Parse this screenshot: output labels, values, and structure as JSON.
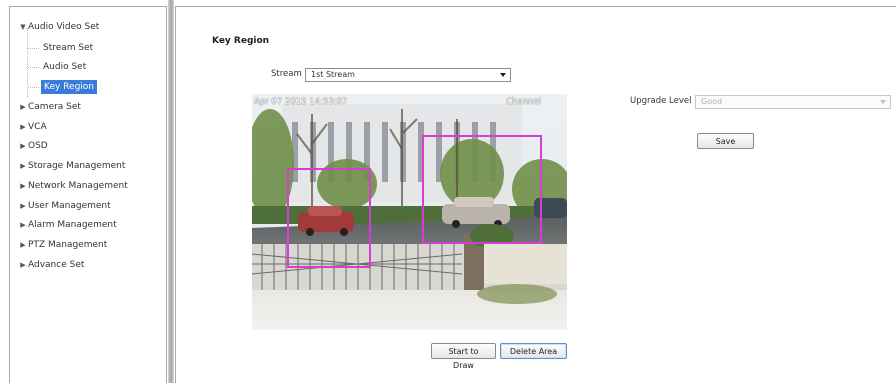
{
  "sidebar": {
    "root_expanded": {
      "label": "Audio Video Set",
      "arrow": "▼"
    },
    "children": [
      {
        "label": "Stream Set"
      },
      {
        "label": "Audio Set"
      },
      {
        "label": "Key Region",
        "selected": true
      }
    ],
    "collapsed_items": [
      {
        "label": "Camera Set"
      },
      {
        "label": "VCA"
      },
      {
        "label": "OSD"
      },
      {
        "label": "Storage Management"
      },
      {
        "label": "Network Management"
      },
      {
        "label": "User Management"
      },
      {
        "label": "Alarm Management"
      },
      {
        "label": "PTZ Management"
      },
      {
        "label": "Advance Set"
      }
    ],
    "collapsed_arrow": "▶"
  },
  "main": {
    "title": "Key Region",
    "stream_label": "Stream",
    "stream_value": "1st Stream",
    "video": {
      "timestamp": "Apr 07 2015 14:53:07",
      "channel": "Channel"
    },
    "upgrade_label": "Upgrade Level",
    "upgrade_value": "Good",
    "save_label": "Save",
    "start_draw_label": "Start to Draw",
    "delete_area_label": "Delete Area"
  },
  "colors": {
    "region_outline": "#d93cd3",
    "selected_item": "#3a7dd8"
  }
}
